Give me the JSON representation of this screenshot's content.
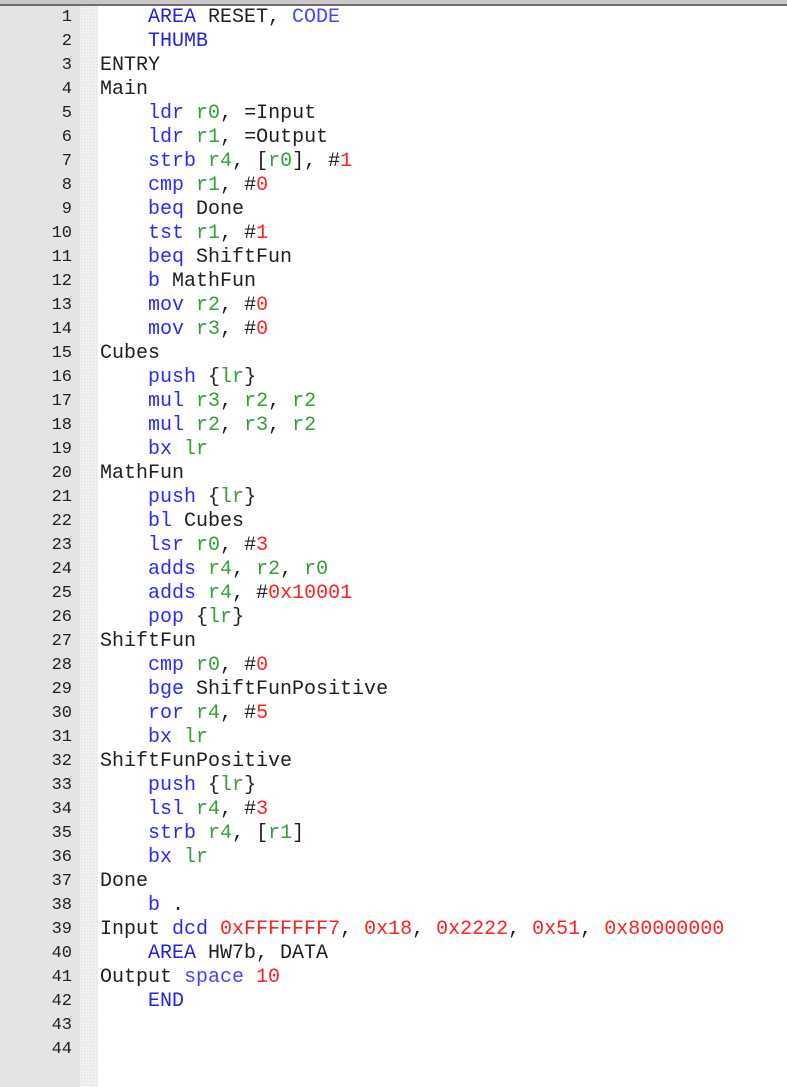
{
  "colors": {
    "directive": "#2222dd",
    "keyword": "#2a2aff",
    "register": "#33a033",
    "number": "#ff2020",
    "text": "#202020",
    "gutter": "#e4e4e4"
  },
  "lines": [
    [
      [
        "    ",
        "plain"
      ],
      [
        "AREA",
        "dir"
      ],
      [
        " RESET, ",
        "plain"
      ],
      [
        "CODE",
        "dir2"
      ]
    ],
    [
      [
        "    ",
        "plain"
      ],
      [
        "THUMB",
        "dir"
      ]
    ],
    [
      [
        "ENTRY",
        "plain"
      ]
    ],
    [
      [
        "Main",
        "plain"
      ]
    ],
    [
      [
        "    ",
        "plain"
      ],
      [
        "ldr",
        "kw"
      ],
      [
        " ",
        "plain"
      ],
      [
        "r0",
        "reg"
      ],
      [
        ", =Input",
        "plain"
      ]
    ],
    [
      [
        "    ",
        "plain"
      ],
      [
        "ldr",
        "kw"
      ],
      [
        " ",
        "plain"
      ],
      [
        "r1",
        "reg"
      ],
      [
        ", =Output",
        "plain"
      ]
    ],
    [
      [
        "    ",
        "plain"
      ],
      [
        "strb",
        "kw"
      ],
      [
        " ",
        "plain"
      ],
      [
        "r4",
        "reg"
      ],
      [
        ", [",
        "plain"
      ],
      [
        "r0",
        "reg"
      ],
      [
        "], #",
        "plain"
      ],
      [
        "1",
        "num"
      ]
    ],
    [
      [
        "    ",
        "plain"
      ],
      [
        "cmp",
        "kw"
      ],
      [
        " ",
        "plain"
      ],
      [
        "r1",
        "reg"
      ],
      [
        ", #",
        "plain"
      ],
      [
        "0",
        "num"
      ]
    ],
    [
      [
        "    ",
        "plain"
      ],
      [
        "beq",
        "kw"
      ],
      [
        " Done",
        "plain"
      ]
    ],
    [
      [
        "    ",
        "plain"
      ],
      [
        "tst",
        "kw"
      ],
      [
        " ",
        "plain"
      ],
      [
        "r1",
        "reg"
      ],
      [
        ", #",
        "plain"
      ],
      [
        "1",
        "num"
      ]
    ],
    [
      [
        "    ",
        "plain"
      ],
      [
        "beq",
        "kw"
      ],
      [
        " ShiftFun",
        "plain"
      ]
    ],
    [
      [
        "    ",
        "plain"
      ],
      [
        "b",
        "kw"
      ],
      [
        " MathFun",
        "plain"
      ]
    ],
    [
      [
        "    ",
        "plain"
      ],
      [
        "mov",
        "kw"
      ],
      [
        " ",
        "plain"
      ],
      [
        "r2",
        "reg"
      ],
      [
        ", #",
        "plain"
      ],
      [
        "0",
        "num"
      ]
    ],
    [
      [
        "    ",
        "plain"
      ],
      [
        "mov",
        "kw"
      ],
      [
        " ",
        "plain"
      ],
      [
        "r3",
        "reg"
      ],
      [
        ", #",
        "plain"
      ],
      [
        "0",
        "num"
      ]
    ],
    [
      [
        "Cubes",
        "plain"
      ]
    ],
    [
      [
        "    ",
        "plain"
      ],
      [
        "push",
        "kw"
      ],
      [
        " {",
        "plain"
      ],
      [
        "lr",
        "reg"
      ],
      [
        "}",
        "plain"
      ]
    ],
    [
      [
        "    ",
        "plain"
      ],
      [
        "mul",
        "kw"
      ],
      [
        " ",
        "plain"
      ],
      [
        "r3",
        "reg"
      ],
      [
        ", ",
        "plain"
      ],
      [
        "r2",
        "reg"
      ],
      [
        ", ",
        "plain"
      ],
      [
        "r2",
        "reg"
      ]
    ],
    [
      [
        "    ",
        "plain"
      ],
      [
        "mul",
        "kw"
      ],
      [
        " ",
        "plain"
      ],
      [
        "r2",
        "reg"
      ],
      [
        ", ",
        "plain"
      ],
      [
        "r3",
        "reg"
      ],
      [
        ", ",
        "plain"
      ],
      [
        "r2",
        "reg"
      ]
    ],
    [
      [
        "    ",
        "plain"
      ],
      [
        "bx",
        "kw"
      ],
      [
        " ",
        "plain"
      ],
      [
        "lr",
        "reg"
      ]
    ],
    [
      [
        "MathFun",
        "plain"
      ]
    ],
    [
      [
        "    ",
        "plain"
      ],
      [
        "push",
        "kw"
      ],
      [
        " {",
        "plain"
      ],
      [
        "lr",
        "reg"
      ],
      [
        "}",
        "plain"
      ]
    ],
    [
      [
        "    ",
        "plain"
      ],
      [
        "bl",
        "kw"
      ],
      [
        " Cubes",
        "plain"
      ]
    ],
    [
      [
        "    ",
        "plain"
      ],
      [
        "lsr",
        "kw"
      ],
      [
        " ",
        "plain"
      ],
      [
        "r0",
        "reg"
      ],
      [
        ", #",
        "plain"
      ],
      [
        "3",
        "num"
      ]
    ],
    [
      [
        "    ",
        "plain"
      ],
      [
        "adds",
        "kw"
      ],
      [
        " ",
        "plain"
      ],
      [
        "r4",
        "reg"
      ],
      [
        ", ",
        "plain"
      ],
      [
        "r2",
        "reg"
      ],
      [
        ", ",
        "plain"
      ],
      [
        "r0",
        "reg"
      ]
    ],
    [
      [
        "    ",
        "plain"
      ],
      [
        "adds",
        "kw"
      ],
      [
        " ",
        "plain"
      ],
      [
        "r4",
        "reg"
      ],
      [
        ", #",
        "plain"
      ],
      [
        "0x10001",
        "num"
      ]
    ],
    [
      [
        "    ",
        "plain"
      ],
      [
        "pop",
        "kw"
      ],
      [
        " {",
        "plain"
      ],
      [
        "lr",
        "reg"
      ],
      [
        "}",
        "plain"
      ]
    ],
    [
      [
        "ShiftFun",
        "plain"
      ]
    ],
    [
      [
        "    ",
        "plain"
      ],
      [
        "cmp",
        "kw"
      ],
      [
        " ",
        "plain"
      ],
      [
        "r0",
        "reg"
      ],
      [
        ", #",
        "plain"
      ],
      [
        "0",
        "num"
      ]
    ],
    [
      [
        "    ",
        "plain"
      ],
      [
        "bge",
        "kw"
      ],
      [
        " ShiftFunPositive",
        "plain"
      ]
    ],
    [
      [
        "    ",
        "plain"
      ],
      [
        "ror",
        "kw"
      ],
      [
        " ",
        "plain"
      ],
      [
        "r4",
        "reg"
      ],
      [
        ", #",
        "plain"
      ],
      [
        "5",
        "num"
      ]
    ],
    [
      [
        "    ",
        "plain"
      ],
      [
        "bx",
        "kw"
      ],
      [
        " ",
        "plain"
      ],
      [
        "lr",
        "reg"
      ]
    ],
    [
      [
        "ShiftFunPositive",
        "plain"
      ]
    ],
    [
      [
        "    ",
        "plain"
      ],
      [
        "push",
        "kw"
      ],
      [
        " {",
        "plain"
      ],
      [
        "lr",
        "reg"
      ],
      [
        "}",
        "plain"
      ]
    ],
    [
      [
        "    ",
        "plain"
      ],
      [
        "lsl",
        "kw"
      ],
      [
        " ",
        "plain"
      ],
      [
        "r4",
        "reg"
      ],
      [
        ", #",
        "plain"
      ],
      [
        "3",
        "num"
      ]
    ],
    [
      [
        "    ",
        "plain"
      ],
      [
        "strb",
        "kw"
      ],
      [
        " ",
        "plain"
      ],
      [
        "r4",
        "reg"
      ],
      [
        ", [",
        "plain"
      ],
      [
        "r1",
        "reg"
      ],
      [
        "]",
        "plain"
      ]
    ],
    [
      [
        "    ",
        "plain"
      ],
      [
        "bx",
        "kw"
      ],
      [
        " ",
        "plain"
      ],
      [
        "lr",
        "reg"
      ]
    ],
    [
      [
        "Done",
        "plain"
      ]
    ],
    [
      [
        "    ",
        "plain"
      ],
      [
        "b",
        "kw"
      ],
      [
        " .",
        "plain"
      ]
    ],
    [
      [
        "Input ",
        "plain"
      ],
      [
        "dcd",
        "kw"
      ],
      [
        " ",
        "plain"
      ],
      [
        "0xFFFFFFF7",
        "num"
      ],
      [
        ", ",
        "plain"
      ],
      [
        "0x18",
        "num"
      ],
      [
        ", ",
        "plain"
      ],
      [
        "0x2222",
        "num"
      ],
      [
        ", ",
        "plain"
      ],
      [
        "0x51",
        "num"
      ],
      [
        ", ",
        "plain"
      ],
      [
        "0x80000000",
        "num"
      ]
    ],
    [
      [
        "    ",
        "plain"
      ],
      [
        "AREA",
        "dir"
      ],
      [
        " HW7b, DATA",
        "plain"
      ]
    ],
    [
      [
        "Output ",
        "plain"
      ],
      [
        "space",
        "dir2"
      ],
      [
        " ",
        "plain"
      ],
      [
        "10",
        "num"
      ]
    ],
    [
      [
        "    ",
        "plain"
      ],
      [
        "END",
        "dir"
      ]
    ],
    [],
    []
  ]
}
